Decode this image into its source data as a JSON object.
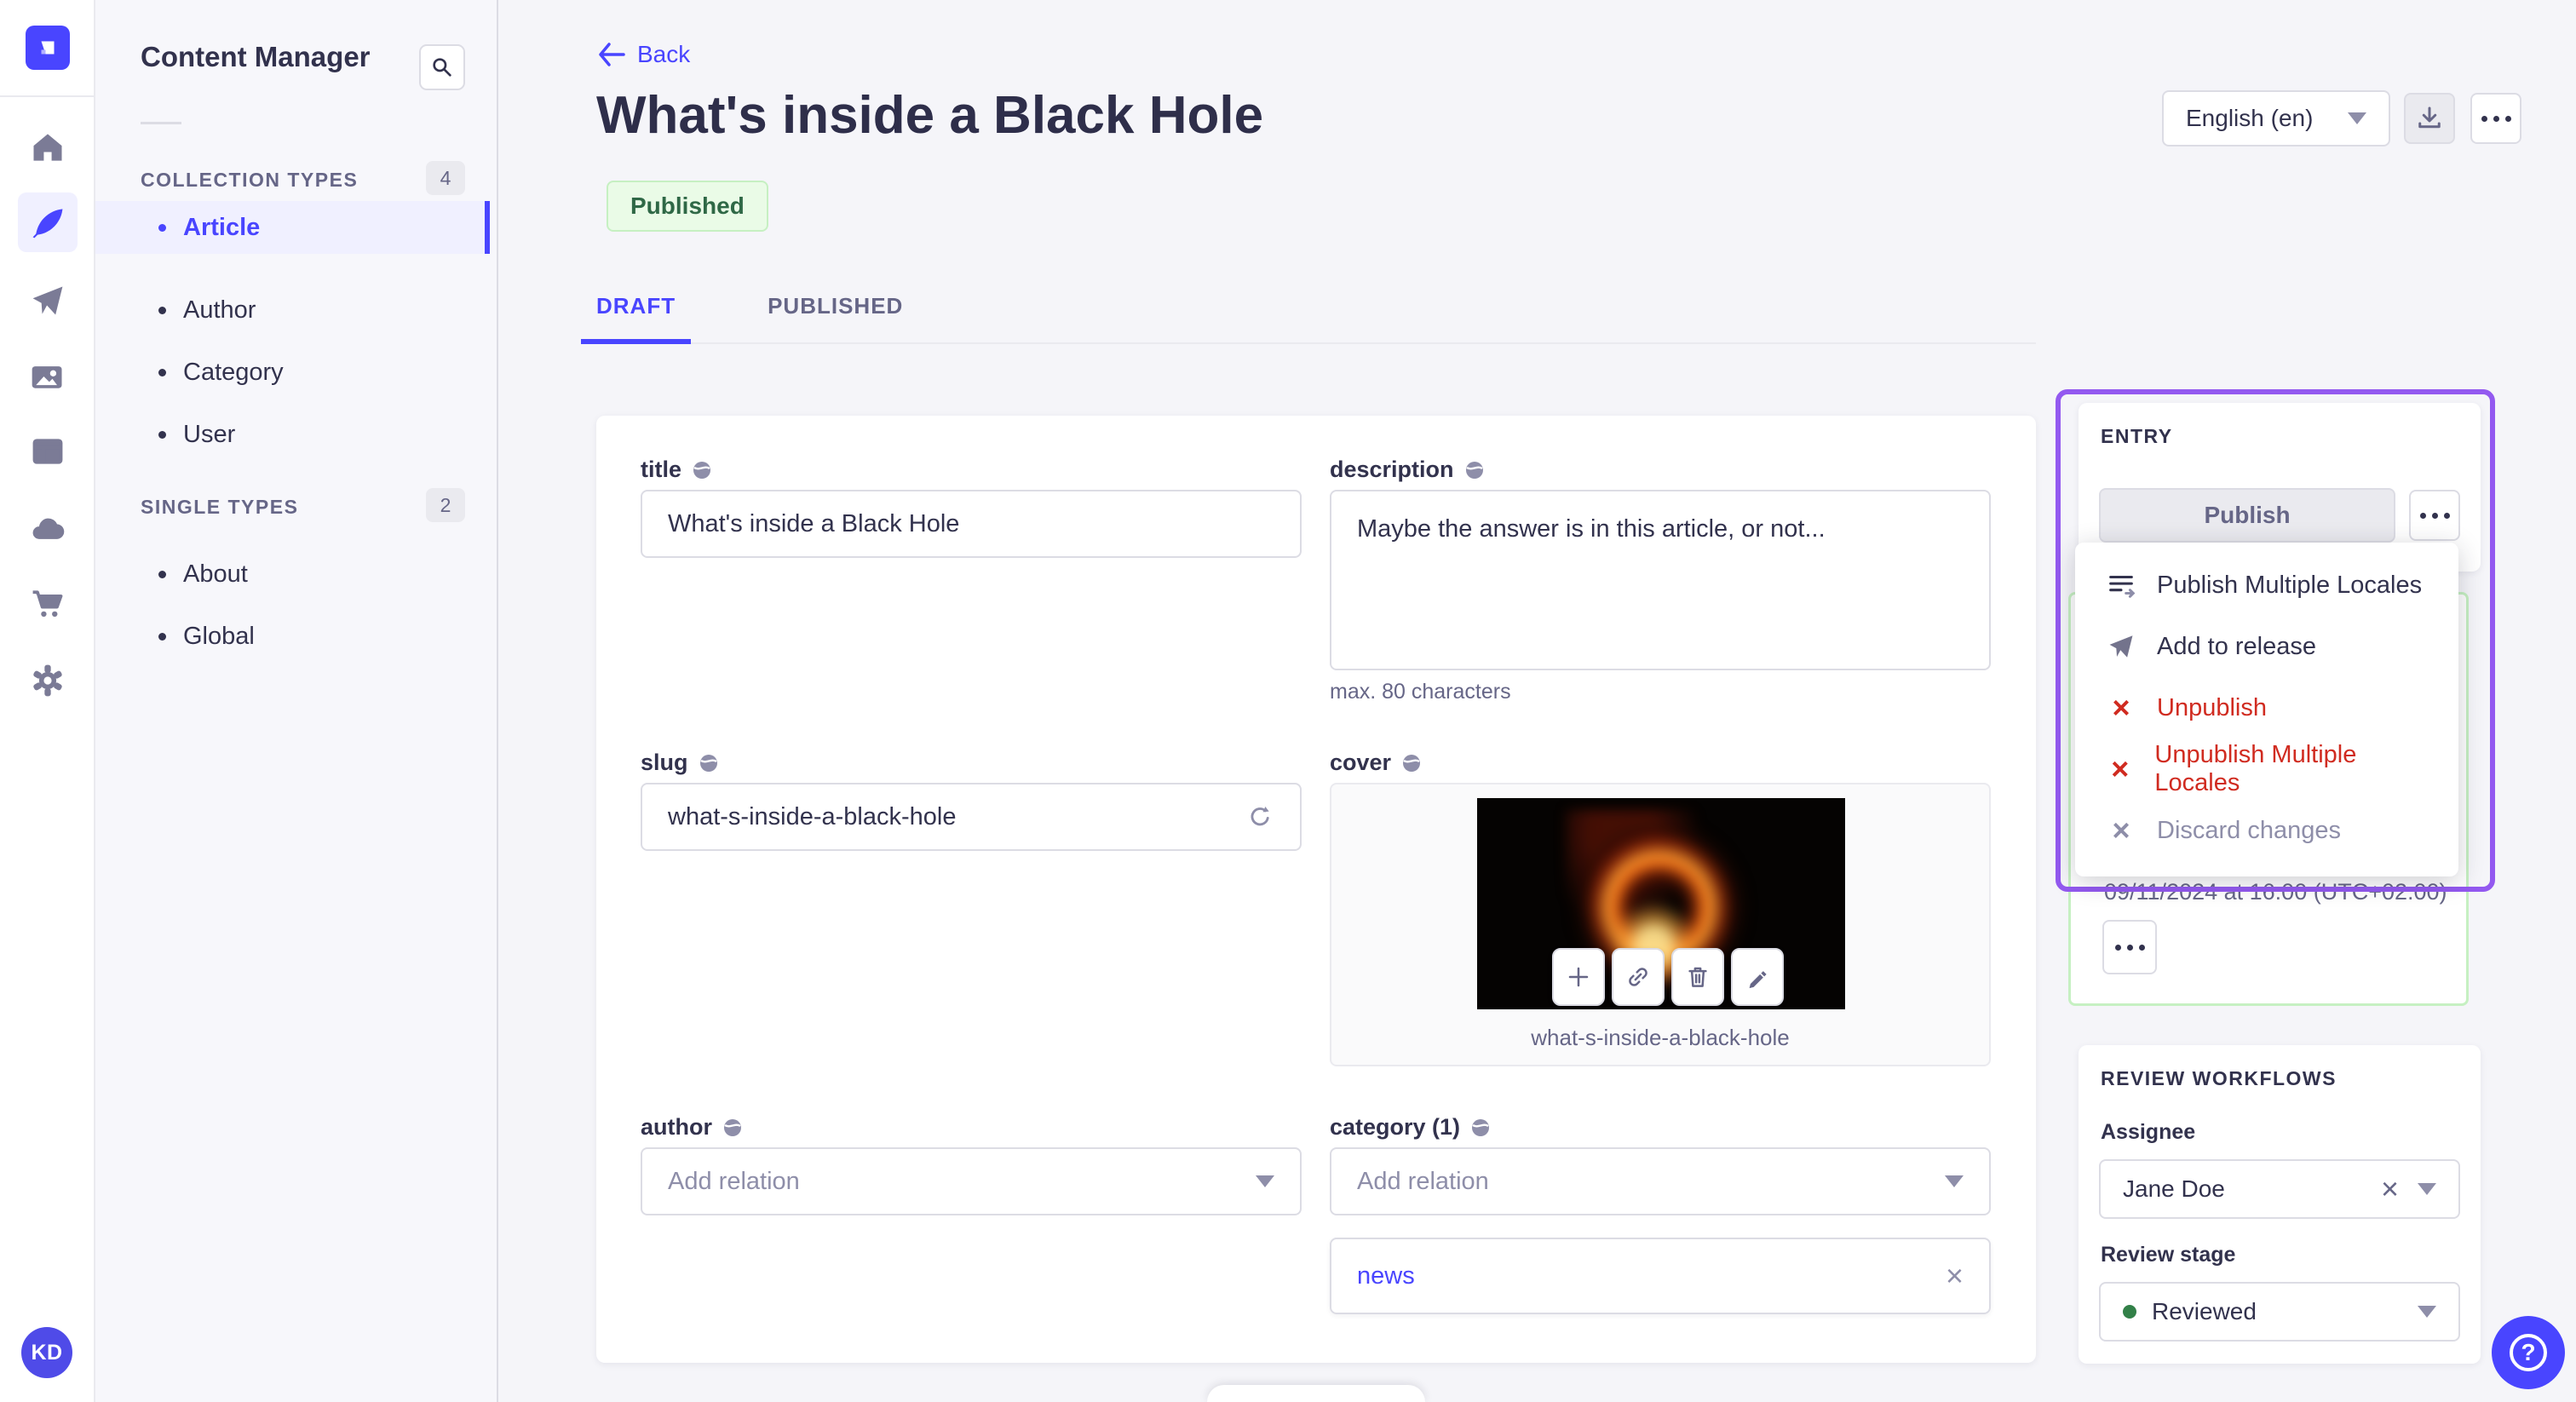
{
  "colors": {
    "accent": "#4945FF",
    "tour_outline": "#9359F0",
    "danger": "#D02B20",
    "success_text": "#2F6846",
    "stage_dot": "#328048"
  },
  "rail": {
    "avatar_initials": "KD",
    "items": [
      "home",
      "content-manager",
      "releases",
      "media-library",
      "content-type-builder",
      "cloud",
      "marketplace",
      "settings"
    ]
  },
  "subnav": {
    "title": "Content Manager",
    "collection_header": "COLLECTION TYPES",
    "collection_count": "4",
    "collection_items": [
      {
        "label": "Article"
      },
      {
        "label": "Author"
      },
      {
        "label": "Category"
      },
      {
        "label": "User"
      }
    ],
    "single_header": "SINGLE TYPES",
    "single_count": "2",
    "single_items": [
      {
        "label": "About"
      },
      {
        "label": "Global"
      }
    ]
  },
  "header": {
    "back": "Back",
    "title": "What's inside a Black Hole",
    "status": "Published",
    "locale": "English (en)"
  },
  "tabs": {
    "draft": "DRAFT",
    "published": "PUBLISHED"
  },
  "form": {
    "title": {
      "label": "title",
      "value": "What's inside a Black Hole"
    },
    "description": {
      "label": "description",
      "value": "Maybe the answer is in this article, or not...",
      "hint": "max. 80 characters"
    },
    "slug": {
      "label": "slug",
      "value": "what-s-inside-a-black-hole"
    },
    "cover": {
      "label": "cover",
      "caption": "what-s-inside-a-black-hole"
    },
    "author": {
      "label": "author",
      "placeholder": "Add relation"
    },
    "category": {
      "label": "category (1)",
      "placeholder": "Add relation",
      "relation": "news"
    }
  },
  "entry": {
    "header": "ENTRY",
    "publish_label": "Publish",
    "menu": [
      {
        "label": "Publish Multiple Locales"
      },
      {
        "label": "Add to release"
      },
      {
        "label": "Unpublish"
      },
      {
        "label": "Unpublish Multiple Locales"
      },
      {
        "label": "Discard changes"
      }
    ],
    "scheduled_date": "09/11/2024 at 16:00 (UTC+02:00)"
  },
  "review": {
    "header": "REVIEW WORKFLOWS",
    "assignee_label": "Assignee",
    "assignee_value": "Jane Doe",
    "stage_label": "Review stage",
    "stage_value": "Reviewed"
  }
}
